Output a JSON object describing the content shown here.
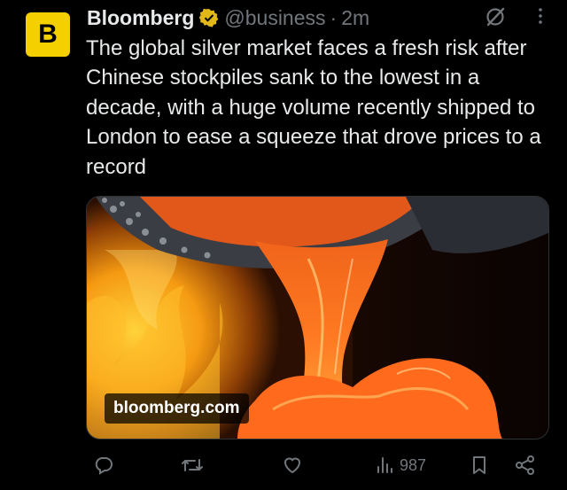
{
  "tweet": {
    "avatar_letter": "B",
    "display_name": "Bloomberg",
    "handle": "@business",
    "separator": "·",
    "time": "2m",
    "text": "The global silver market faces a fresh risk after Chinese stockpiles sank to the lowest in a decade, with a huge volume recently shipped to London to ease a squeeze that drove prices to a record",
    "media": {
      "source_label": "bloomberg.com"
    }
  },
  "actions": {
    "views_count": "987"
  },
  "colors": {
    "brand_yellow": "#f5d000",
    "verified_gold": "#e2b719",
    "muted_text": "#71767b",
    "primary_text": "#e7e9ea"
  },
  "icons": [
    "verified-badge-icon",
    "grok-icon",
    "more-icon",
    "reply-icon",
    "retweet-icon",
    "like-icon",
    "views-icon",
    "bookmark-icon",
    "share-icon"
  ]
}
